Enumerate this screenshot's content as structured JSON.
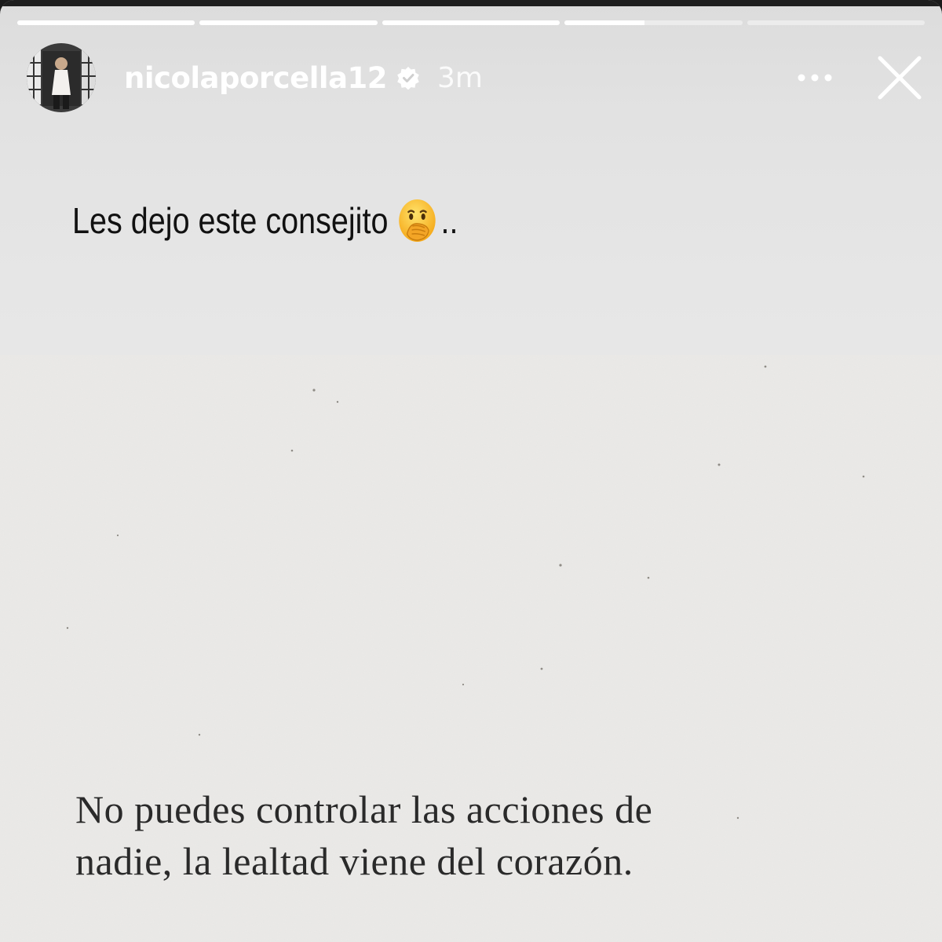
{
  "story": {
    "progress_segments": [
      1,
      1,
      1,
      0.45,
      0
    ],
    "user": {
      "username": "nicolaporcella12",
      "verified": true,
      "time_ago": "3m"
    },
    "icons": {
      "more": "more-horizontal-icon",
      "close": "close-icon",
      "verified": "verified-badge-icon"
    },
    "caption": {
      "text": "Les dejo este consejito",
      "emoji": "face-with-hand-over-mouth",
      "suffix": ".."
    },
    "quote": {
      "line1": "No puedes controlar las acciones de",
      "line2": "nadie, la lealtad viene del corazón."
    }
  },
  "colors": {
    "header_text": "#ffffff",
    "caption_text": "#111111",
    "quote_text": "#2a2a2a",
    "card_bg": "#ebeae8"
  }
}
